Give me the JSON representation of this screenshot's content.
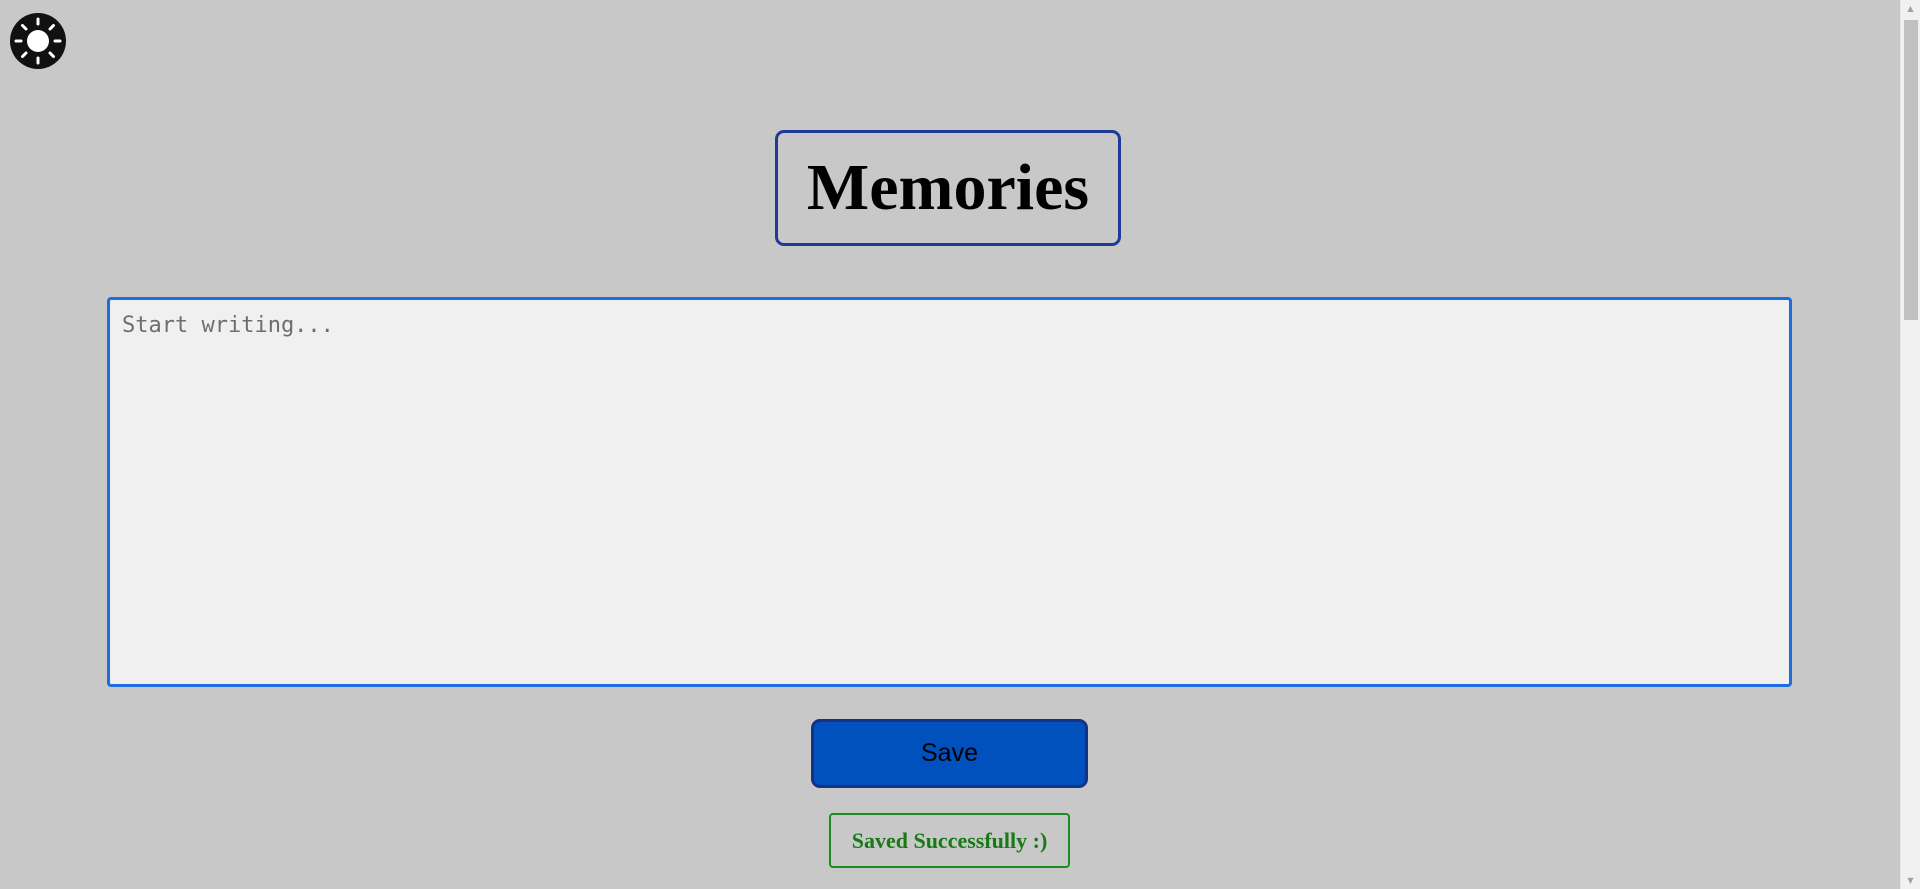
{
  "theme_toggle": {
    "icon": "sun-icon"
  },
  "header": {
    "title": "Memories"
  },
  "editor": {
    "placeholder": "Start writing...",
    "value": ""
  },
  "actions": {
    "save_label": "Save"
  },
  "status": {
    "message": "Saved Successfully :)"
  },
  "colors": {
    "background": "#c8c8c8",
    "title_border": "#1f3a99",
    "editor_border": "#1f6ce0",
    "editor_background": "#f0f0f0",
    "save_button": "#0050be",
    "status_text": "#167a16"
  }
}
